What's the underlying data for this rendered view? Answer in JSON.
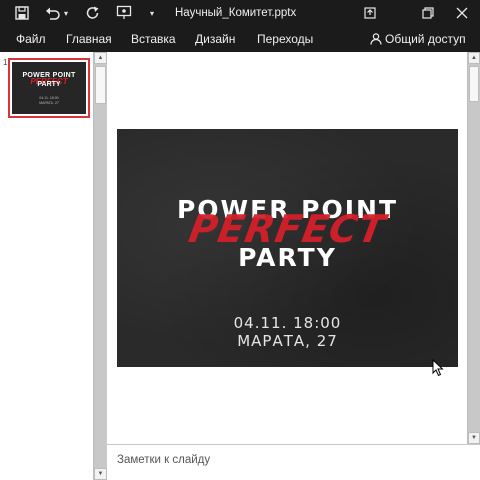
{
  "titlebar": {
    "filename": "Научный_Комитет.pptx",
    "icons": [
      "save-icon",
      "undo-icon",
      "undo-dropdown-icon",
      "redo-icon",
      "slideshow-icon",
      "customize-icon"
    ],
    "window_buttons": [
      "fullscreen-icon",
      "restore-icon",
      "close-icon"
    ]
  },
  "menu": {
    "items": [
      "Файл",
      "Главная",
      "Вставка",
      "Дизайн",
      "Переходы"
    ],
    "share_label": "Общий доступ"
  },
  "thumbnails": {
    "slide_number": "1"
  },
  "slide": {
    "title_line1": "POWER POINT",
    "accent": "PERFECT",
    "title_line2": "PARTY",
    "date": "04.11. 18:00",
    "place": "МАРАТА, 27",
    "thumb_date": "04.11. 18:00",
    "thumb_place": "МАРАТА, 27"
  },
  "notes": {
    "placeholder": "Заметки к слайду"
  },
  "colors": {
    "chrome": "#1b1b1b",
    "accent_red": "#d4202a",
    "selection": "#d9343b"
  }
}
